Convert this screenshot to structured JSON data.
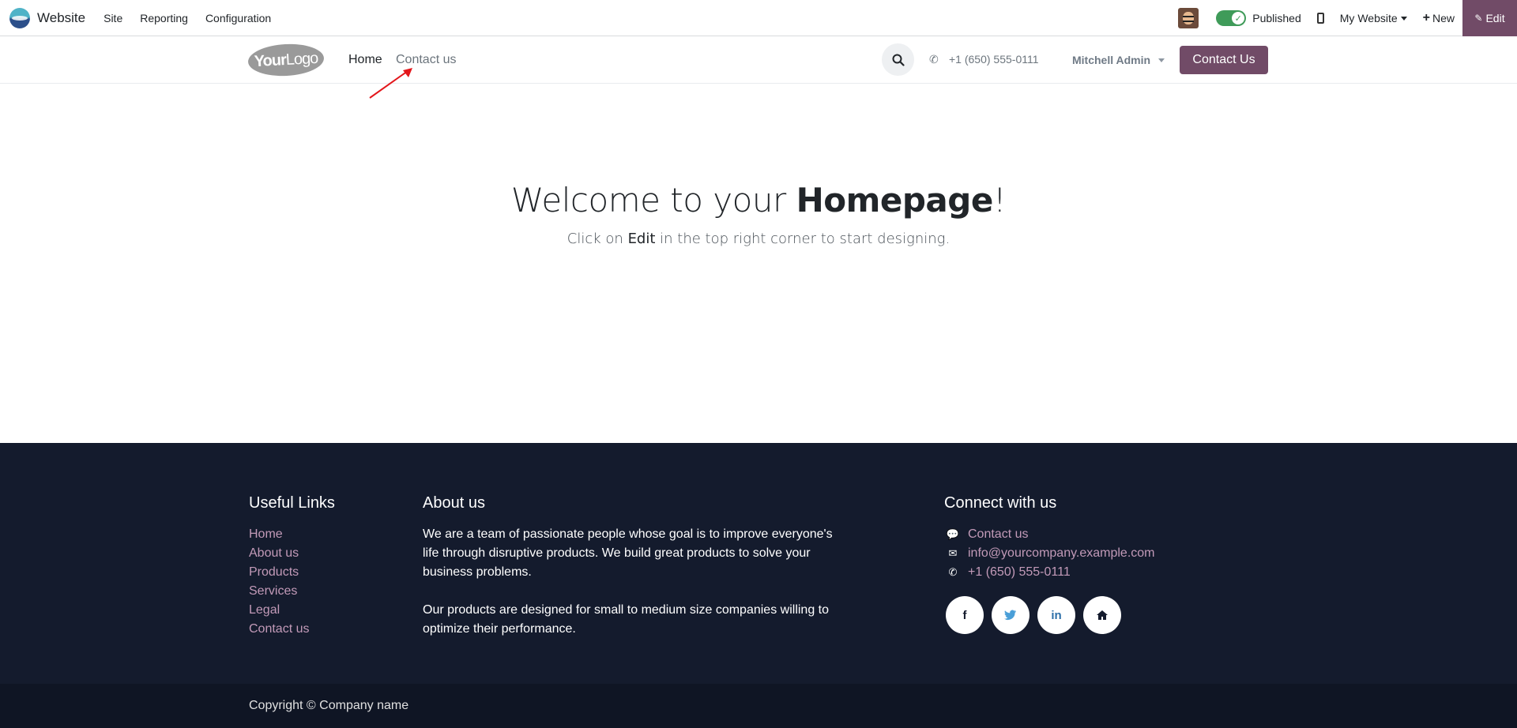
{
  "admin": {
    "app_name": "Website",
    "menu": [
      "Site",
      "Reporting",
      "Configuration"
    ],
    "published_label": "Published",
    "website_selector": "My Website",
    "new_label": "New",
    "edit_label": "Edit"
  },
  "header": {
    "logo_text_bold": "Your",
    "logo_text_light": "Logo",
    "nav": [
      "Home",
      "Contact us"
    ],
    "phone": "+1 (650) 555-0111",
    "user": "Mitchell Admin",
    "cta": "Contact Us"
  },
  "main": {
    "title_prefix": "Welcome to your ",
    "title_bold": "Homepage",
    "title_suffix": "!",
    "subtitle_prefix": "Click on ",
    "subtitle_strong": "Edit",
    "subtitle_suffix": " in the top right corner to start designing."
  },
  "footer": {
    "useful_links": {
      "title": "Useful Links",
      "items": [
        "Home",
        "About us",
        "Products",
        "Services",
        "Legal",
        "Contact us"
      ]
    },
    "about": {
      "title": "About us",
      "paragraph1": "We are a team of passionate people whose goal is to improve everyone's life through disruptive products. We build great products to solve your business problems.",
      "paragraph2": "Our products are designed for small to medium size companies willing to optimize their performance."
    },
    "connect": {
      "title": "Connect with us",
      "contact": "Contact us",
      "email": "info@yourcompany.example.com",
      "phone": "+1 (650) 555-0111",
      "socials": [
        "facebook-icon",
        "twitter-icon",
        "linkedin-icon",
        "home-icon"
      ]
    },
    "copyright": "Copyright © Company name"
  },
  "colors": {
    "brand": "#714b67",
    "footer_bg": "#141b2d",
    "footer_link": "#c29ab8",
    "published_toggle": "#3f9b59"
  }
}
